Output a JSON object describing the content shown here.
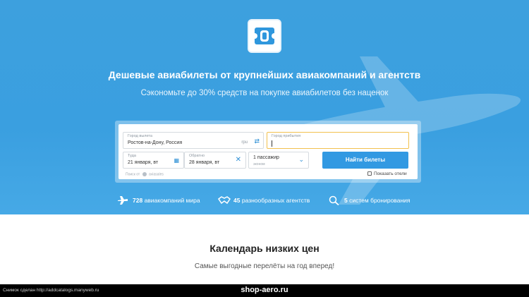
{
  "hero": {
    "headline": "Дешевые авиабилеты от крупнейших авиакомпаний и агентств",
    "subline": "Сэкономьте до 30% средств на покупке авиабилетов без наценок",
    "logo_icon": "ticket-logo-icon",
    "accent_color": "#3da0de"
  },
  "search": {
    "from_label": "Город вылета",
    "from_value": "Ростов-на-Дону, Россия",
    "from_code": "rpu",
    "to_label": "Город прибытия",
    "to_value": "",
    "depart_label": "Туда",
    "depart_value": "21 января, вт",
    "return_label": "Обратно",
    "return_value": "28 января, вт",
    "passengers_value": "1 пассажир",
    "class_value": "эконом",
    "button_label": "Найти билеты",
    "button_color": "#3299e2",
    "powered_prefix": "Поиск от",
    "powered_name": "aviasales",
    "show_hotels": "Показать отели"
  },
  "stats": [
    {
      "number": "728",
      "text": "авиакомпаний мира",
      "icon": "airplane-icon"
    },
    {
      "number": "45",
      "text": "разнообразных агентств",
      "icon": "handshake-icon"
    },
    {
      "number": "5",
      "text": "систем бронирования",
      "icon": "search-icon"
    }
  ],
  "calendar": {
    "title": "Календарь низких цен",
    "subtitle": "Самые выгодные перелёты на год вперед!"
  },
  "footer": {
    "credit": "Снимок сделан http://addcatalogs.manyweb.ru",
    "domain": "shop-aero.ru"
  }
}
